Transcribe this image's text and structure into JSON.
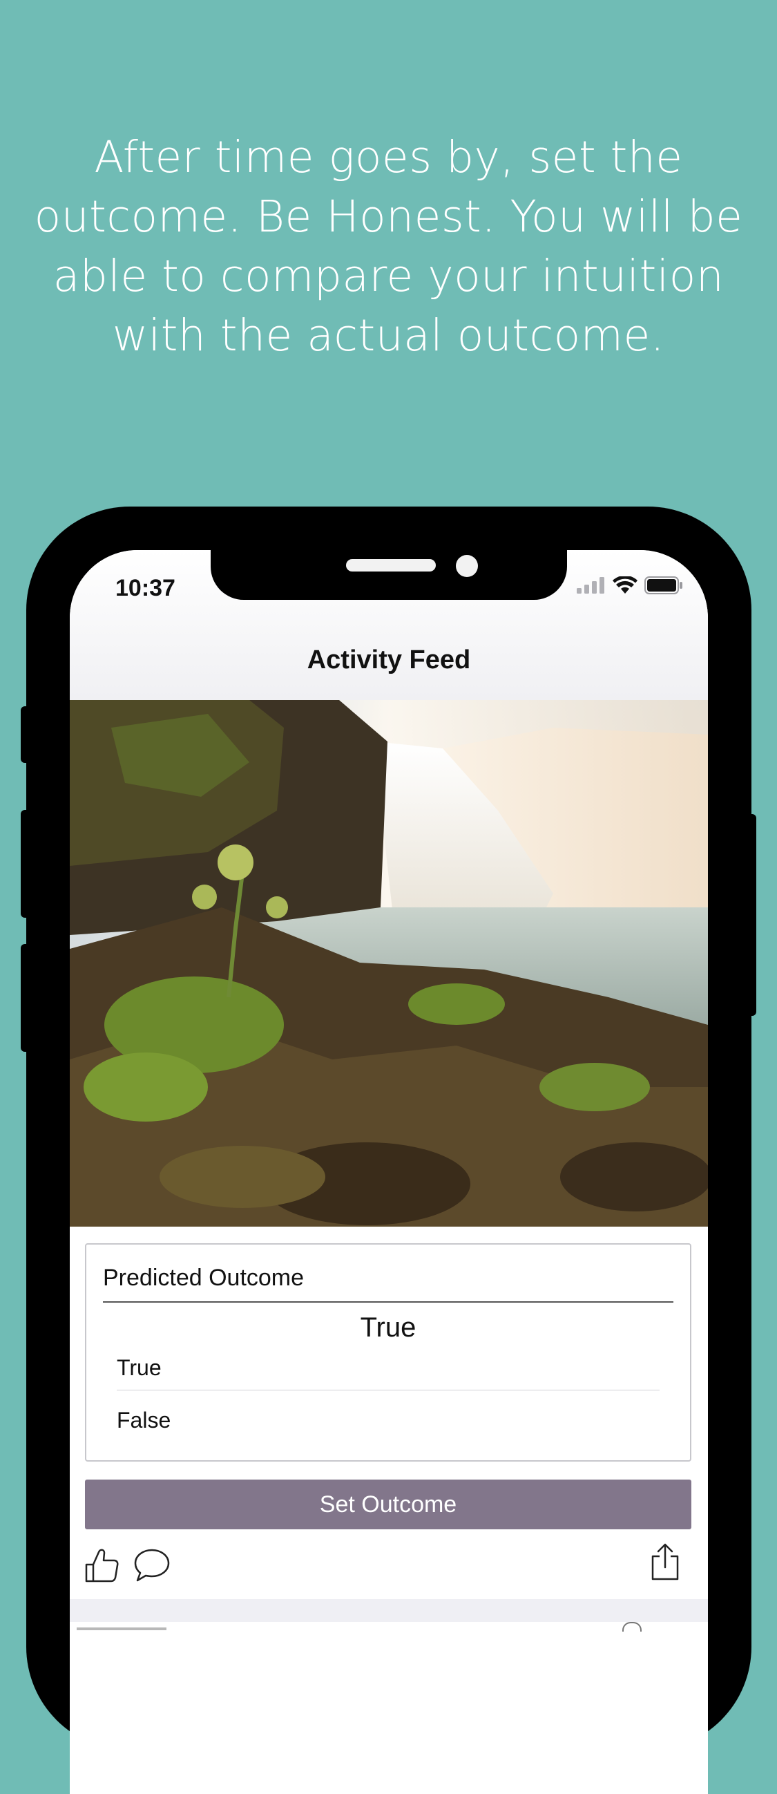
{
  "headline": "After time goes by, set the\noutcome. Be Honest. You will be\nable to compare your intuition\nwith the actual outcome.",
  "status": {
    "time": "10:37"
  },
  "nav": {
    "title": "Activity Feed"
  },
  "post": {
    "image_alt": "Waterfall landscape with green plants and rocks",
    "prediction_label": "Predicted Outcome",
    "selected_value": "True",
    "options": [
      "True",
      "False"
    ],
    "set_outcome_label": "Set Outcome"
  },
  "icons": {
    "like": "thumbs-up-icon",
    "comment": "speech-bubble-icon",
    "share": "share-icon",
    "signal": "cell-signal-icon",
    "wifi": "wifi-icon",
    "battery": "battery-icon"
  },
  "colors": {
    "background": "#70bcb5",
    "button": "#82768b",
    "phone_frame": "#000000"
  }
}
